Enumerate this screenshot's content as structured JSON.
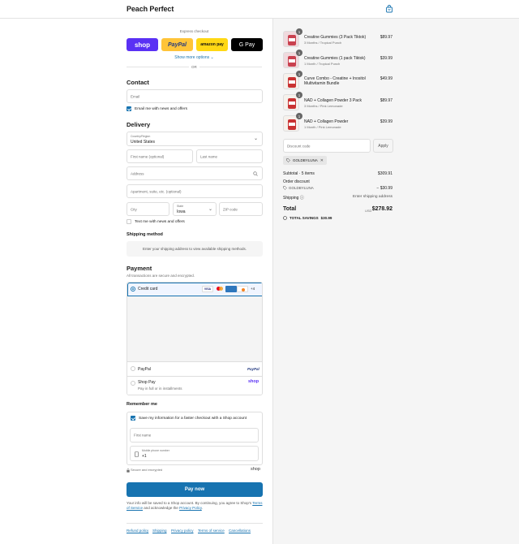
{
  "header": {
    "store_name": "Peach Perfect",
    "cart_icon": "shopping-bag-icon"
  },
  "express": {
    "title": "Express checkout",
    "buttons": [
      {
        "label": "shop",
        "color": "#5a31f4"
      },
      {
        "label": "PayPal",
        "color": "#ffc439"
      },
      {
        "label": "amazon pay",
        "color": "#ffd814"
      },
      {
        "label": "G Pay",
        "color": "#000000"
      }
    ],
    "show_more": "Show more options",
    "or": "OR"
  },
  "contact": {
    "title": "Contact",
    "email_placeholder": "Email",
    "news_label": "Email me with news and offers"
  },
  "delivery": {
    "title": "Delivery",
    "country_label": "Country/Region",
    "country_value": "United States",
    "first_name": "First name (optional)",
    "last_name": "Last name",
    "address": "Address",
    "apartment": "Apartment, suite, etc. (optional)",
    "city": "City",
    "state_label": "State",
    "state_value": "Iowa",
    "zip": "ZIP code",
    "text_news": "Text me with news and offers"
  },
  "shipping_method": {
    "title": "Shipping method",
    "message": "Enter your shipping address to view available shipping methods."
  },
  "payment": {
    "title": "Payment",
    "subtitle": "All transactions are secure and encrypted.",
    "credit_card": "Credit card",
    "card_more": "+4",
    "paypal": "PayPal",
    "paypal_logo": "PayPal",
    "shop_pay": "Shop Pay",
    "shop_pay_sub": "Pay in full or in installments",
    "shop_logo": "shop"
  },
  "remember": {
    "title": "Remember me",
    "save_label": "Save my information for a faster checkout with a Shop account",
    "first_name": "First name",
    "phone_label": "Mobile phone number",
    "phone_value": "+1",
    "secure": "Secure and encrypted",
    "shop_logo": "shop"
  },
  "pay_button": "Pay now",
  "disclaimer": {
    "text1": "Your info will be saved to a Shop account. By continuing, you agree to Shop's",
    "terms": "Terms of Service",
    "text2": "and acknowledge the",
    "privacy": "Privacy Policy",
    "end": "."
  },
  "footer_links": [
    "Refund policy",
    "Shipping",
    "Privacy policy",
    "Terms of service",
    "Cancellations"
  ],
  "cart": {
    "items": [
      {
        "qty": "1",
        "name": "Creatine Gummies (3 Pack Tiktok)",
        "variant": "3 Months / Tropical Punch",
        "price": "$89.97"
      },
      {
        "qty": "1",
        "name": "Creatine Gummies (1 pack Tiktok)",
        "variant": "1 Month / Tropical Punch",
        "price": "$39.99"
      },
      {
        "qty": "1",
        "name": "Curve Combo - Creatine + Inositol Multivitamin Bundle",
        "variant": "",
        "price": "$49.99"
      },
      {
        "qty": "1",
        "name": "NAD + Collagen Powder 3 Pack",
        "variant": "3 Months / Pink Lemonade",
        "price": "$89.97"
      },
      {
        "qty": "1",
        "name": "NAD + Collagen Powder",
        "variant": "1 Month / Pink Lemonade",
        "price": "$39.99"
      }
    ],
    "discount_placeholder": "Discount code",
    "apply": "Apply",
    "applied_code": "GOLDBYLUNA",
    "subtotal_label": "Subtotal · 5 items",
    "subtotal_value": "$309.91",
    "order_discount_label": "Order discount",
    "discount_code": "GOLDBYLUNA",
    "discount_value": "− $30.99",
    "shipping_label": "Shipping",
    "shipping_value": "Enter shipping address",
    "total_label": "Total",
    "currency": "USD",
    "total_value": "$278.92",
    "savings_label": "TOTAL SAVINGS",
    "savings_value": "$30.99"
  }
}
